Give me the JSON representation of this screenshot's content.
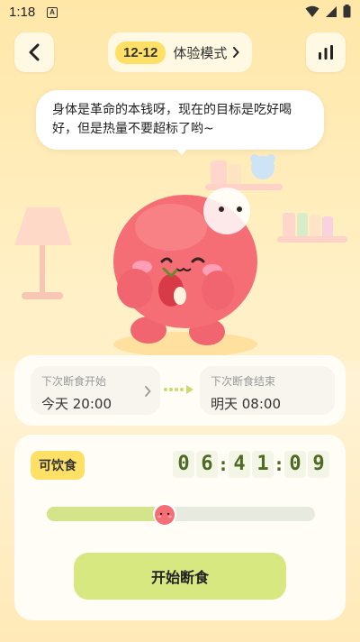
{
  "status_bar": {
    "time": "1:18",
    "notif": "A"
  },
  "header": {
    "date_badge": "12-12",
    "mode_label": "体验模式"
  },
  "bubble": {
    "text": "身体是革命的本钱呀，现在的目标是吃好喝好，但是热量不要超标了哟~"
  },
  "schedule": {
    "start_label": "下次断食开始",
    "start_value": "今天 20:00",
    "end_label": "下次断食结束",
    "end_value": "明天 08:00"
  },
  "timer": {
    "status": "可饮食",
    "digits": [
      "0",
      "6",
      "4",
      "1",
      "0",
      "9"
    ],
    "progress": 0.44,
    "button_label": "开始断食"
  },
  "colors": {
    "accent_yellow": "#ffe066",
    "accent_green": "#d6e87f",
    "character_pink": "#f06a75"
  },
  "icons": [
    "back-icon",
    "chevron-right-icon",
    "bar-chart-icon",
    "wifi-icon",
    "signal-icon",
    "battery-icon"
  ]
}
